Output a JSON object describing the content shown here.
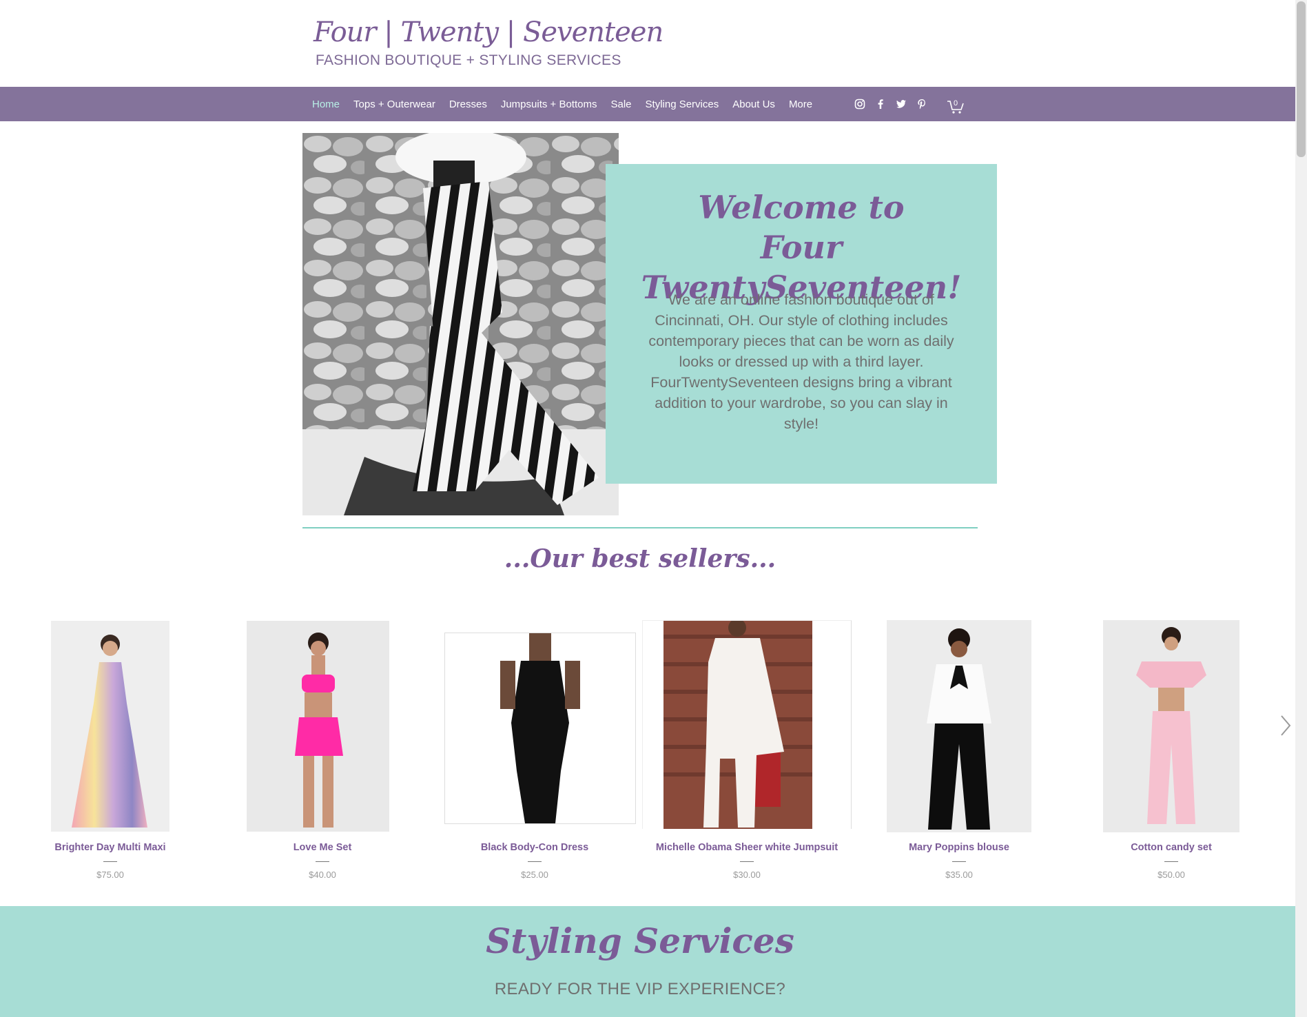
{
  "header": {
    "logo_title": "Four | Twenty | Seventeen",
    "logo_subtitle": "FASHION BOUTIQUE + STYLING SERVICES"
  },
  "nav": {
    "items": [
      {
        "label": "Home",
        "active": true
      },
      {
        "label": "Tops + Outerwear"
      },
      {
        "label": "Dresses"
      },
      {
        "label": "Jumpsuits + Bottoms"
      },
      {
        "label": "Sale"
      },
      {
        "label": "Styling Services"
      },
      {
        "label": "About Us"
      },
      {
        "label": "More"
      }
    ],
    "social_icons": [
      "instagram-icon",
      "facebook-icon",
      "twitter-icon",
      "pinterest-icon"
    ],
    "cart_count": "0"
  },
  "hero": {
    "welcome_line1": "Welcome to",
    "welcome_line2": "Four TwentySeventeen!",
    "body": "We are an online fashion boutique out of Cincinnati, OH.  Our style of clothing includes contemporary pieces that can be worn as daily looks or dressed up with a third layer.  FourTwentySeventeen designs bring a vibrant addition to your wardrobe, so you can slay in style!"
  },
  "best_sellers": {
    "title": "...Our best sellers...",
    "products": [
      {
        "name": "Brighter Day Multi Maxi",
        "price": "$75.00"
      },
      {
        "name": "Love Me Set",
        "price": "$40.00"
      },
      {
        "name": "Black Body-Con Dress",
        "price": "$25.00"
      },
      {
        "name": "Michelle Obama Sheer white Jumpsuit",
        "price": "$30.00"
      },
      {
        "name": "Mary Poppins blouse",
        "price": "$35.00"
      },
      {
        "name": "Cotton candy set",
        "price": "$50.00"
      }
    ]
  },
  "styling": {
    "title": "Styling Services",
    "subtitle": "READY FOR THE VIP EXPERIENCE?"
  },
  "colors": {
    "nav_bg": "#84739b",
    "accent_purple": "#7b5b97",
    "mint": "#a7ddd5",
    "active_nav": "#b8f0e6"
  }
}
